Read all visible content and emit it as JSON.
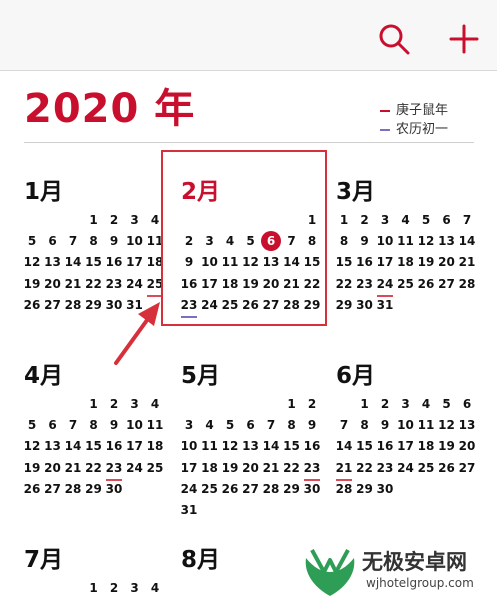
{
  "header": {
    "search_icon": "search-icon",
    "add_icon": "plus-icon",
    "accent": "#c8102e"
  },
  "year_label": "2020 年",
  "legend": {
    "ganzhi": "庚子鼠年",
    "lunar": "农历初一"
  },
  "months": [
    {
      "title": "1月",
      "start": 3,
      "days": 31,
      "festival": [
        25
      ],
      "solar": []
    },
    {
      "title": "2月",
      "start": 6,
      "days": 29,
      "today": 6,
      "festival": [],
      "solar": [
        23
      ],
      "current": true
    },
    {
      "title": "3月",
      "start": 0,
      "days": 31,
      "festival": [
        24
      ],
      "solar": []
    },
    {
      "title": "4月",
      "start": 3,
      "days": 30,
      "festival": [
        23
      ],
      "solar": []
    },
    {
      "title": "5月",
      "start": 5,
      "days": 31,
      "festival": [
        23
      ],
      "solar": []
    },
    {
      "title": "6月",
      "start": 1,
      "days": 30,
      "festival": [
        21
      ],
      "solar": []
    },
    {
      "title": "7月",
      "start": 3,
      "days": 4,
      "festival": [],
      "solar": []
    },
    {
      "title": "8月",
      "start": 6,
      "days": 0,
      "festival": [],
      "solar": []
    }
  ],
  "watermark": {
    "title": "无极安卓网",
    "url": "wjhotelgroup.com"
  }
}
